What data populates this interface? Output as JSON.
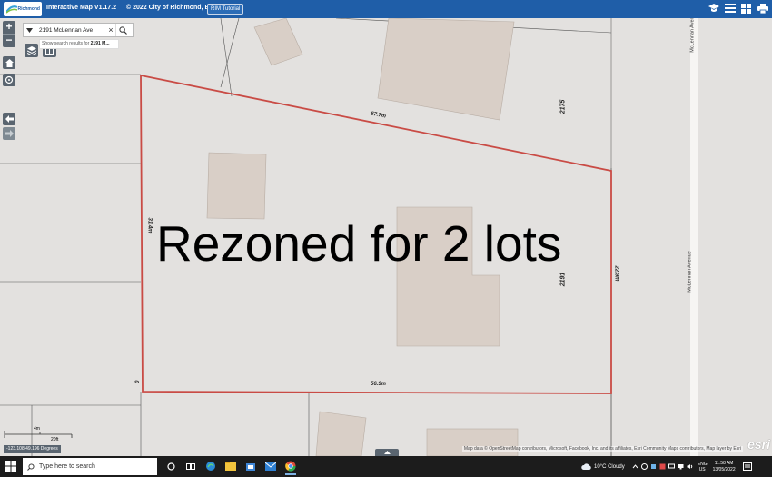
{
  "header": {
    "logo_text": "Richmond",
    "app_title": "Interactive Map V1.17.2",
    "copyright": "© 2022 City of Richmond, BC",
    "tutorial_label": "RIM Tutorial"
  },
  "search": {
    "value": "2191 McLennan Ave",
    "hint_prefix": "Show search results for ",
    "hint_term": "2191 M..."
  },
  "map": {
    "overlay_text": "Rezoned for 2 lots",
    "dimensions": {
      "top": "57.7m",
      "left": "31.4m",
      "right": "22",
      "right_unit": "9m",
      "bottom": "56.9m",
      "corner": "0"
    },
    "addresses": {
      "main": "2191",
      "north": "2175"
    },
    "street": "McLennan Avenue",
    "scale_labels": [
      "4m",
      "20ft"
    ],
    "coordinates": "-123.108 49.196 Degrees",
    "attribution": "Map data © OpenStreetMap contributors, Microsoft, Facebook, Inc. and its affiliates, Esri Community Maps contributors, Map layer by Esri",
    "esri_logo": "esri",
    "parcel_color": "#c94b45",
    "building_color": "#d9cfc7"
  },
  "taskbar": {
    "search_placeholder": "Type here to search",
    "weather": "10°C  Cloudy",
    "lang_top": "ENG",
    "lang_bottom": "US",
    "time": "11:58 AM",
    "date": "13/05/2022"
  }
}
